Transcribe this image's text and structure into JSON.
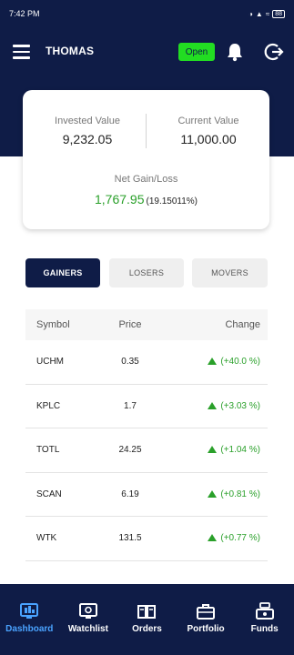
{
  "status_bar": {
    "time": "7:42 PM",
    "battery": "88"
  },
  "header": {
    "user_name": "THOMAS",
    "market_status": "Open"
  },
  "summary": {
    "invested_label": "Invested Value",
    "invested_value": "9,232.05",
    "current_label": "Current Value",
    "current_value": "11,000.00",
    "gain_label": "Net Gain/Loss",
    "gain_value": "1,767.95",
    "gain_pct": "(19.15011%)"
  },
  "tabs": [
    {
      "label": "GAINERS",
      "active": true
    },
    {
      "label": "LOSERS",
      "active": false
    },
    {
      "label": "MOVERS",
      "active": false
    }
  ],
  "table": {
    "headers": {
      "symbol": "Symbol",
      "price": "Price",
      "change": "Change"
    },
    "rows": [
      {
        "symbol": "UCHM",
        "price": "0.35",
        "change": "(+40.0 %)"
      },
      {
        "symbol": "KPLC",
        "price": "1.7",
        "change": "(+3.03 %)"
      },
      {
        "symbol": "TOTL",
        "price": "24.25",
        "change": "(+1.04 %)"
      },
      {
        "symbol": "SCAN",
        "price": "6.19",
        "change": "(+0.81 %)"
      },
      {
        "symbol": "WTK",
        "price": "131.5",
        "change": "(+0.77 %)"
      }
    ]
  },
  "nav": [
    {
      "label": "Dashboard",
      "icon": "dashboard-icon",
      "active": true
    },
    {
      "label": "Watchlist",
      "icon": "watchlist-icon",
      "active": false
    },
    {
      "label": "Orders",
      "icon": "orders-icon",
      "active": false
    },
    {
      "label": "Portfolio",
      "icon": "portfolio-icon",
      "active": false
    },
    {
      "label": "Funds",
      "icon": "funds-icon",
      "active": false
    }
  ],
  "colors": {
    "primary": "#0f1c47",
    "accent_green": "#22dd22",
    "gain_green": "#2aa02a",
    "active_nav": "#4aa3ff"
  }
}
